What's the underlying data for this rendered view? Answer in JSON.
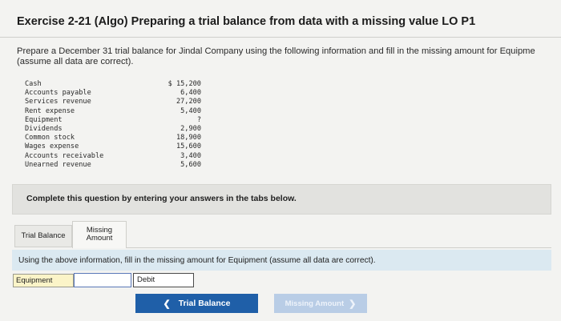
{
  "header": {
    "title": "Exercise 2-21 (Algo) Preparing a trial balance from data with a missing value LO P1"
  },
  "intro": {
    "line1": "Prepare a December 31 trial balance for Jindal Company using the following information and fill in the missing amount for Equipme",
    "line2": "(assume all data are correct)."
  },
  "ledger": [
    {
      "label": "Cash",
      "value": "$ 15,200"
    },
    {
      "label": "Accounts payable",
      "value": "6,400"
    },
    {
      "label": "Services revenue",
      "value": "27,200"
    },
    {
      "label": "Rent expense",
      "value": "5,400"
    },
    {
      "label": "Equipment",
      "value": "?"
    },
    {
      "label": "Dividends",
      "value": "2,900"
    },
    {
      "label": "Common stock",
      "value": "18,900"
    },
    {
      "label": "Wages expense",
      "value": "15,600"
    },
    {
      "label": "Accounts receivable",
      "value": "3,400"
    },
    {
      "label": "Unearned revenue",
      "value": "5,600"
    }
  ],
  "banner": {
    "text": "Complete this question by entering your answers in the tabs below."
  },
  "tabs": {
    "trial_balance": "Trial Balance",
    "missing_line1": "Missing",
    "missing_line2": "Amount"
  },
  "instruction": "Using the above information, fill in the missing amount for Equipment (assume all data are correct).",
  "answer": {
    "label": "Equipment",
    "input_value": "",
    "side": "Debit"
  },
  "nav": {
    "prev_icon": "chevron-left-icon",
    "prev_label": "Trial Balance",
    "next_label": "Missing Amount",
    "next_icon": "chevron-right-icon"
  },
  "colors": {
    "primary": "#1f5fa8",
    "disabled": "#b9cde6",
    "instruction_bg": "#dbe9f1",
    "label_bg": "#fbf4c8"
  }
}
